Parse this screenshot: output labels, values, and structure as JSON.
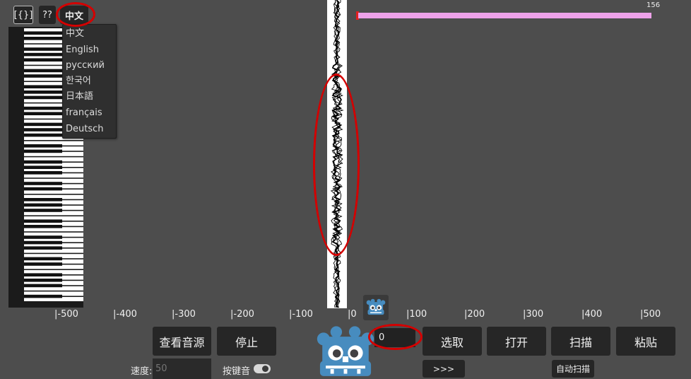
{
  "toolbar": {
    "brackets_label": "[{}]",
    "help_label": "??",
    "language_label": "中文"
  },
  "language_menu": {
    "items": [
      "中文",
      "English",
      "русский",
      "한국어",
      "日本語",
      "français",
      "Deutsch"
    ]
  },
  "progress": {
    "max_label": "156",
    "color": "#eea2ea"
  },
  "ruler": {
    "ticks": [
      "|-500",
      "|-400",
      "|-300",
      "|-200",
      "|-100",
      "|0",
      "|100",
      "|200",
      "|300",
      "|400",
      "|500"
    ]
  },
  "controls": {
    "view_source_label": "查看音源",
    "stop_label": "停止",
    "number_value": "0",
    "select_label": "选取",
    "open_label": "打开",
    "scan_label": "扫描",
    "paste_label": "粘贴",
    "speed_label": "速度:",
    "speed_placeholder": "50",
    "key_sound_label": "按键音",
    "forward_label": ">>>",
    "auto_scan_label": "自动扫描"
  },
  "icons": {
    "godot_small": "godot-icon",
    "godot_large": "godot-logo-icon"
  },
  "colors": {
    "background": "#4d4d4d",
    "button": "#262626",
    "highlight_ring": "#d40000",
    "godot_blue": "#478cbf"
  }
}
